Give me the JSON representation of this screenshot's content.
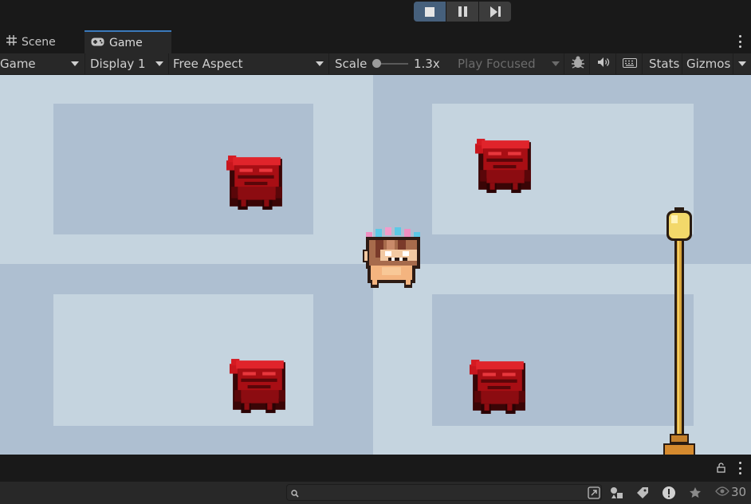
{
  "playbar": {
    "buttons": [
      {
        "name": "stop-button",
        "icon": "stop-icon",
        "active": true
      },
      {
        "name": "pause-button",
        "icon": "pause-icon",
        "active": false
      },
      {
        "name": "step-button",
        "icon": "step-icon",
        "active": false
      }
    ]
  },
  "tabs": {
    "scene_label": "Scene",
    "game_label": "Game"
  },
  "toolbar": {
    "view_mode": "Game",
    "display": "Display 1",
    "aspect": "Free Aspect",
    "scale_label": "Scale",
    "scale_value": "1.3x",
    "play_mode": "Play Focused",
    "stats_label": "Stats",
    "gizmos_label": "Gizmos"
  },
  "status": {
    "search_placeholder": "",
    "visible_count": "30"
  },
  "colors": {
    "accent": "#3a79bb",
    "play_active": "#46607c",
    "floor_light": "#c5d4df",
    "floor_dark": "#aebfd1",
    "enemy_red": "#c8161d"
  }
}
